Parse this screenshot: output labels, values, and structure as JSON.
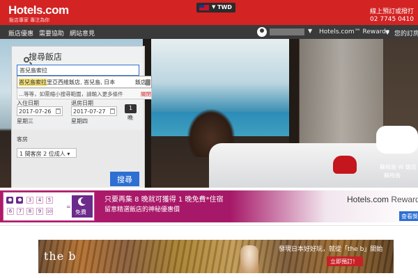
{
  "header": {
    "logo": "Hotels.com",
    "tagline": "飯店專家 專注為你",
    "currency": "TWD",
    "phone_label": "線上預訂或撥打",
    "phone_number": "02 7745 0410"
  },
  "nav": {
    "items": [
      "飯店優惠",
      "需要協助",
      "網站意見"
    ],
    "rewards": "Hotels.com™ Rewards",
    "trips": "您的訂房"
  },
  "search": {
    "title": "搜尋飯店",
    "destination_value": "峇兒島索拉",
    "suggestion_highlight": "峇兒島索拉",
    "suggestion_rest": "里亞西維飯店, 峇兒島, 日本",
    "suggestion_tag": "飯店",
    "hint_text": "...等等，如需縮小搜尋範圍，請輸入更多條件",
    "hint_close": "關閉",
    "checkin_label": "入住日期",
    "checkin_value": "2017-07-26",
    "checkin_day": "星期三",
    "checkout_label": "退房日期",
    "checkout_value": "2017-07-27",
    "checkout_day": "星期四",
    "nights": "1",
    "nights_label": "晚",
    "rooms_label": "客房",
    "rooms_value": "1 間客房 2 位成人",
    "submit": "搜尋"
  },
  "hero": {
    "caption_line1": "蘇梅島 W 飯店",
    "caption_line2": "蘇梅島"
  },
  "promo": {
    "line1": "只要再集 8 晚就可獲得 1 晚免費*住宿",
    "line2": "留意精選飯店的神秘優惠價",
    "stamps": [
      "3",
      "4",
      "5",
      "6",
      "7",
      "8",
      "9",
      "10"
    ],
    "free_label": "免費",
    "rewards_logo": "Hotels.com",
    "rewards_word": "Rewards",
    "view_button": "查看獎勵"
  },
  "ad": {
    "brand": "the b",
    "message": "發現日本好好玩，就從「the b」開始",
    "cta": "立即預訂！"
  },
  "colors": {
    "brand_red": "#d32323",
    "nav_dark": "#3a3a3a",
    "button_blue": "#2d6fd2",
    "promo_magenta": "#a61868"
  }
}
